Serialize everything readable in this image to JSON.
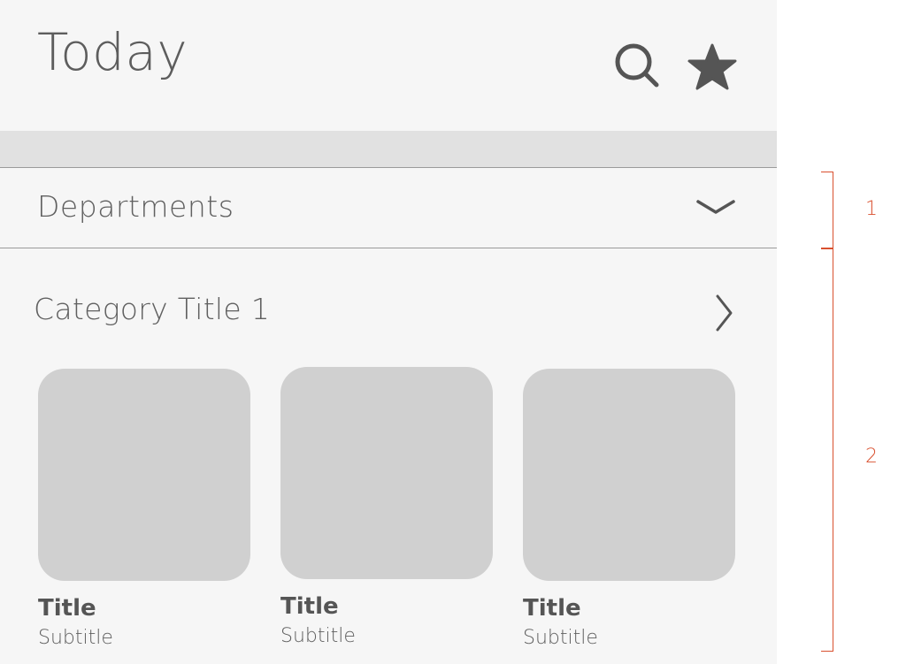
{
  "header": {
    "title": "Today",
    "icons": [
      "search-icon",
      "star-icon"
    ]
  },
  "departments": {
    "label": "Departments",
    "icon": "chevron-down-icon"
  },
  "category": {
    "title": "Category Title 1",
    "icon": "chevron-right-icon",
    "tiles": [
      {
        "title": "Title",
        "subtitle": "Subtitle"
      },
      {
        "title": "Title",
        "subtitle": "Subtitle"
      },
      {
        "title": "Title",
        "subtitle": "Subtitle"
      }
    ]
  },
  "annotations": [
    {
      "label": "1"
    },
    {
      "label": "2"
    }
  ],
  "colors": {
    "background": "#f6f6f6",
    "band": "#e1e1e1",
    "tile": "#d0d0d0",
    "text": "#606060",
    "icon": "#555555",
    "annotation": "#d9502f"
  }
}
